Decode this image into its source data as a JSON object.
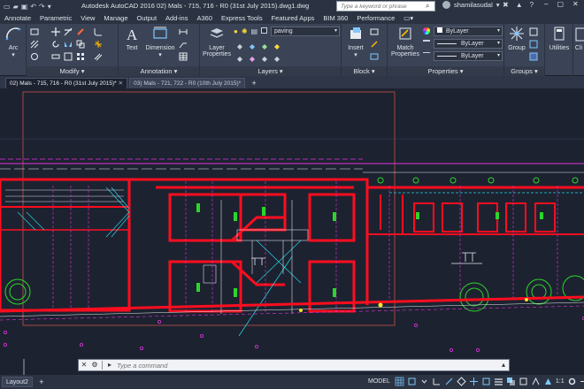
{
  "titlebar": {
    "app_title": "Autodesk AutoCAD 2016    02) Mals - 715, 716 - R0 (31st July 2015).dwg1.dwg",
    "search_placeholder": "Type a keyword or phrase",
    "user_name": "shamilasudal"
  },
  "ribbon_tabs": [
    "Annotate",
    "Parametric",
    "View",
    "Manage",
    "Output",
    "Add-ins",
    "A360",
    "Express Tools",
    "Featured Apps",
    "BIM 360",
    "Performance"
  ],
  "ribbon": {
    "arc_label": "Arc",
    "modify_title": "Modify",
    "text_label": "Text",
    "dimension_label": "Dimension",
    "annotation_title": "Annotation",
    "layer_properties_label": "Layer Properties",
    "layer_combo": "paving",
    "layers_title": "Layers",
    "insert_label": "Insert",
    "block_title": "Block",
    "match_properties_label": "Match Properties",
    "bylayer_1": "ByLayer",
    "bylayer_2": "ByLayer",
    "bylayer_3": "ByLayer",
    "properties_title": "Properties",
    "group_label": "Group",
    "groups_title": "Groups",
    "utilities_label": "Utilities",
    "clipboard_label": "Cli"
  },
  "doc_tabs": [
    {
      "label": "02) Mals - 715, 716 - R0 (31st July 2015)*"
    },
    {
      "label": "03) Mals - 721, 722 - R0 (10th July 2015)*"
    }
  ],
  "command": {
    "placeholder": "Type a command"
  },
  "statusbar": {
    "layout_tab": "Layout2",
    "model": "MODEL",
    "scale": "1:1"
  },
  "colors": {
    "canvas": "#1d2230",
    "wall_red": "#ff0d1f",
    "magenta": "#e034e0",
    "cyan": "#25d8e8",
    "green": "#2bd62b",
    "white": "#e9edf3"
  }
}
